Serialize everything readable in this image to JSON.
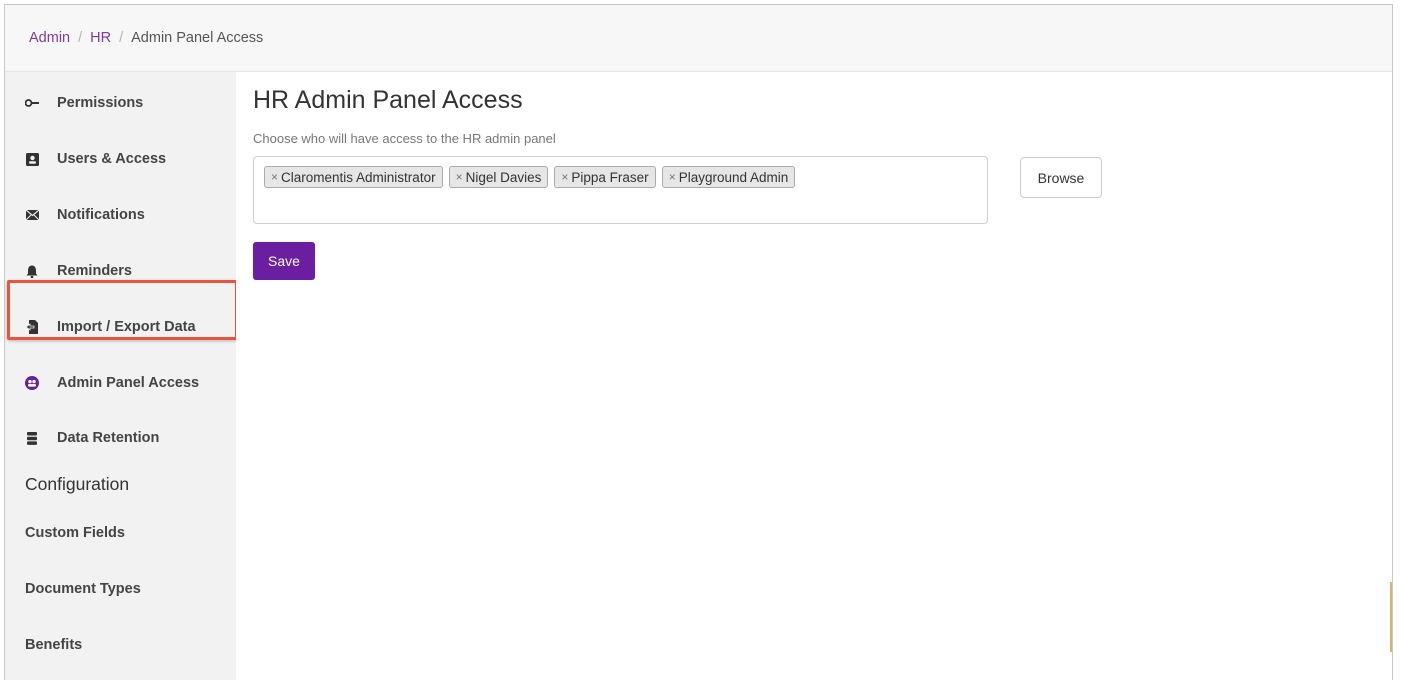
{
  "breadcrumb": {
    "items": [
      "Admin",
      "HR"
    ],
    "separator": "/",
    "current": "Admin Panel Access"
  },
  "sidebar": {
    "items": [
      {
        "label": "Permissions",
        "icon": "key-icon"
      },
      {
        "label": "Users & Access",
        "icon": "user-card-icon"
      },
      {
        "label": "Notifications",
        "icon": "envelope-icon"
      },
      {
        "label": "Reminders",
        "icon": "bell-icon"
      },
      {
        "label": "Import / Export Data",
        "icon": "file-import-icon"
      },
      {
        "label": "Admin Panel Access",
        "icon": "users-circle-icon",
        "active": true
      },
      {
        "label": "Data Retention",
        "icon": "database-icon"
      }
    ],
    "section_heading": "Configuration",
    "sub_items": [
      "Custom Fields",
      "Document Types",
      "Benefits"
    ]
  },
  "main": {
    "title": "HR Admin Panel Access",
    "description": "Choose who will have access to the HR admin panel",
    "tags": [
      "Claromentis Administrator",
      "Nigel Davies",
      "Pippa Fraser",
      "Playground Admin"
    ],
    "tag_remove_glyph": "×",
    "browse_label": "Browse",
    "save_label": "Save"
  },
  "colors": {
    "accent": "#6b1fa0",
    "link": "#7b3aa6",
    "highlight_border": "#e8553f"
  }
}
